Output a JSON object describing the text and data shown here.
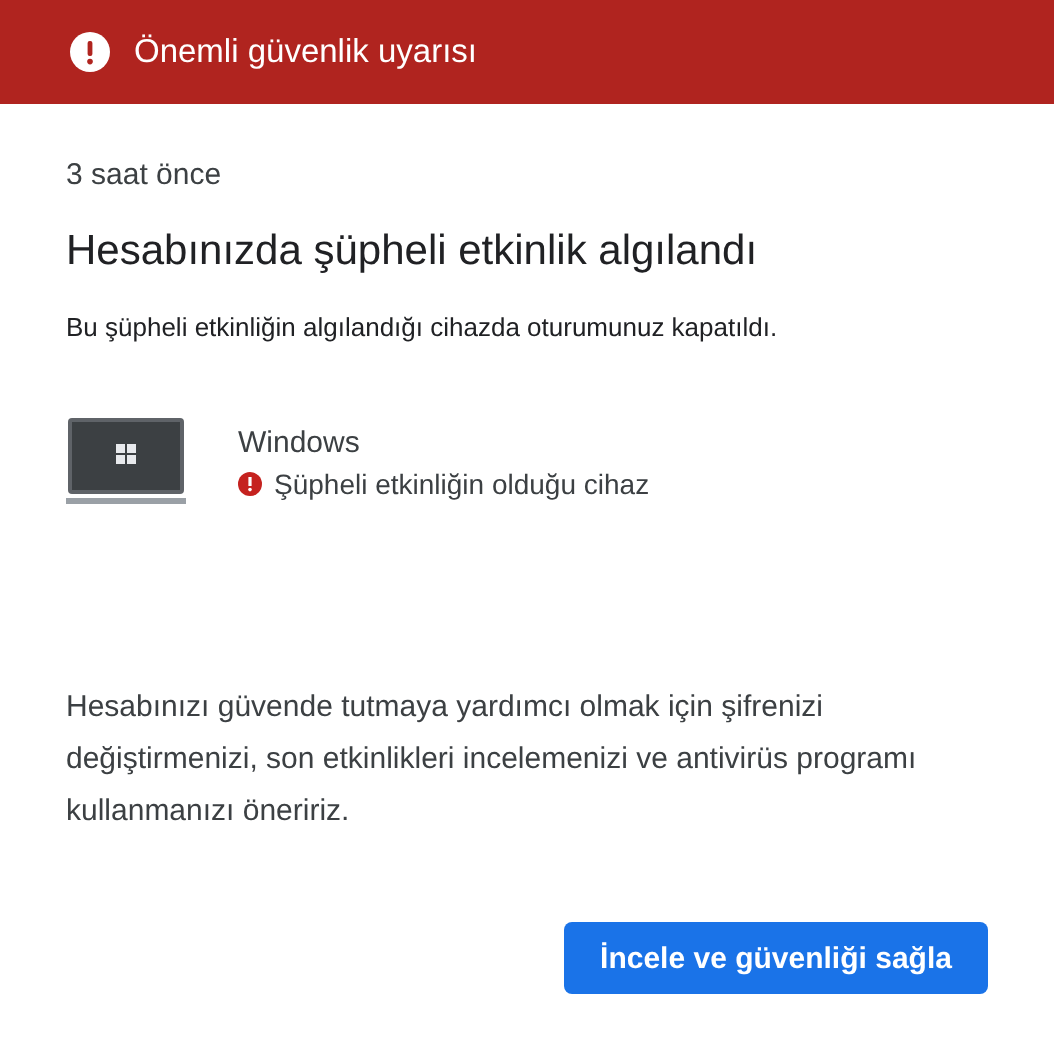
{
  "header": {
    "title": "Önemli güvenlik uyarısı"
  },
  "time": "3 saat önce",
  "heading": "Hesabınızda şüpheli etkinlik algılandı",
  "description": "Bu şüpheli etkinliğin algılandığı cihazda oturumunuz kapatıldı.",
  "device": {
    "name": "Windows",
    "note": "Şüpheli etkinliğin olduğu cihaz"
  },
  "advice": "Hesabınızı güvende tutmaya yardımcı olmak için şifrenizi değiştirmenizi, son etkinlikleri incelemenizi ve antivirüs programı kullanmanızı öneririz.",
  "button": "İncele ve güvenliği sağla"
}
